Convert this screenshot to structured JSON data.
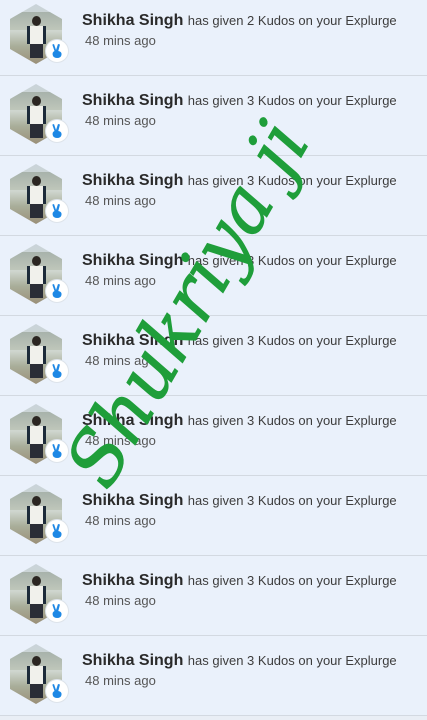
{
  "notifications": [
    {
      "name": "Shikha Singh",
      "message": "has given 2 Kudos on your Explurge",
      "time": "48 mins ago"
    },
    {
      "name": "Shikha Singh",
      "message": "has given 3 Kudos on your Explurge",
      "time": "48 mins ago"
    },
    {
      "name": "Shikha Singh",
      "message": "has given 3 Kudos on your Explurge",
      "time": "48 mins ago"
    },
    {
      "name": "Shikha Singh",
      "message": "has given 3 Kudos on your Explurge",
      "time": "48 mins ago"
    },
    {
      "name": "Shikha Singh",
      "message": "has given 3 Kudos on your Explurge",
      "time": "48 mins ago"
    },
    {
      "name": "Shikha Singh",
      "message": "has given 3 Kudos on your Explurge",
      "time": "48 mins ago"
    },
    {
      "name": "Shikha Singh",
      "message": "has given 3 Kudos on your Explurge",
      "time": "48 mins ago"
    },
    {
      "name": "Shikha Singh",
      "message": "has given 3 Kudos on your Explurge",
      "time": "48 mins ago"
    },
    {
      "name": "Shikha Singh",
      "message": "has given 3 Kudos on your Explurge",
      "time": "48 mins ago"
    }
  ],
  "kudos_icon": "victory-hand-icon",
  "colors": {
    "row_background": "#eaf1fb",
    "kudos_blue": "#1e88e5",
    "watermark_green": "#1f9e3a"
  },
  "overlay": {
    "text": "Shukriya ji"
  }
}
